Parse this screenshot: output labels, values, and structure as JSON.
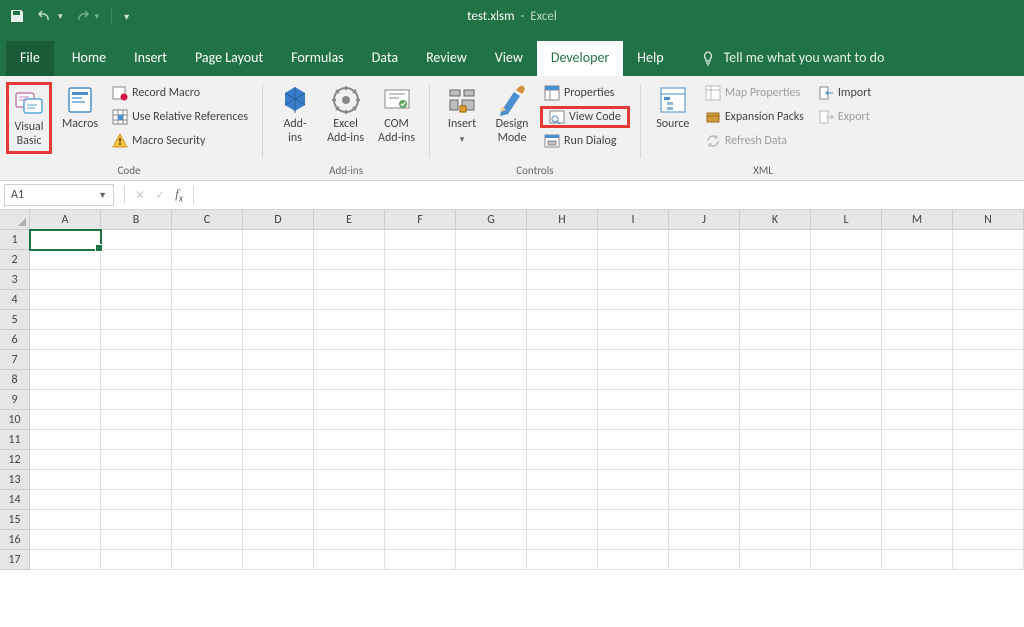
{
  "titlebar": {
    "filename": "test.xlsm",
    "appname": "Excel"
  },
  "tabs": {
    "file": "File",
    "items": [
      "Home",
      "Insert",
      "Page Layout",
      "Formulas",
      "Data",
      "Review",
      "View",
      "Developer",
      "Help"
    ],
    "activeIndex": 7,
    "tellme": "Tell me what you want to do"
  },
  "ribbon": {
    "code": {
      "visual_basic": "Visual\nBasic",
      "macros": "Macros",
      "record_macro": "Record Macro",
      "use_rel_refs": "Use Relative References",
      "macro_security": "Macro Security",
      "label": "Code"
    },
    "addins": {
      "addins": "Add-\nins",
      "excel_addins": "Excel\nAdd-ins",
      "com_addins": "COM\nAdd-ins",
      "label": "Add-ins"
    },
    "controls": {
      "insert": "Insert",
      "design_mode": "Design\nMode",
      "properties": "Properties",
      "view_code": "View Code",
      "run_dialog": "Run Dialog",
      "label": "Controls"
    },
    "xml": {
      "source": "Source",
      "map_properties": "Map Properties",
      "expansion_packs": "Expansion Packs",
      "refresh_data": "Refresh Data",
      "import": "Import",
      "export": "Export",
      "label": "XML"
    }
  },
  "formula_bar": {
    "namebox": "A1",
    "formula": ""
  },
  "grid": {
    "columns": [
      "A",
      "B",
      "C",
      "D",
      "E",
      "F",
      "G",
      "H",
      "I",
      "J",
      "K",
      "L",
      "M",
      "N"
    ],
    "rows": 17,
    "selected": "A1"
  }
}
